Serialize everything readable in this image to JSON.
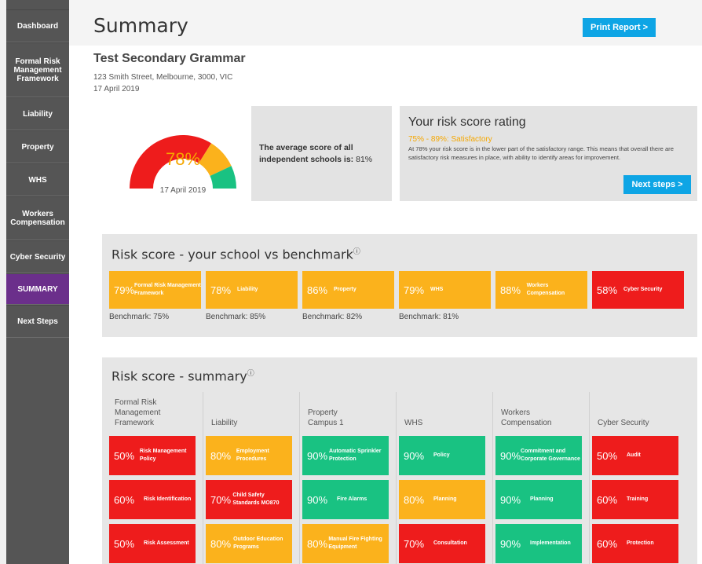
{
  "sidebar": {
    "items": [
      {
        "label": "Dashboard",
        "active": false
      },
      {
        "label": "Formal Risk Management Framework",
        "active": false
      },
      {
        "label": "Liability",
        "active": false
      },
      {
        "label": "Property",
        "active": false
      },
      {
        "label": "WHS",
        "active": false
      },
      {
        "label": "Workers Compensation",
        "active": false
      },
      {
        "label": "Cyber Security",
        "active": false
      },
      {
        "label": "SUMMARY",
        "active": true
      },
      {
        "label": "Next Steps",
        "active": false
      }
    ]
  },
  "header": {
    "title": "Summary",
    "print_label": "Print Report >"
  },
  "school": {
    "name": "Test Secondary Grammar",
    "address": "123 Smith Street, Melbourne, 3000, VIC",
    "date": "17 April 2019"
  },
  "gauge": {
    "score_text": "78%",
    "score": 78,
    "date": "17 April 2019"
  },
  "average": {
    "label": "The average score of all independent schools is:",
    "value": "81%"
  },
  "rating": {
    "title": "Your risk score rating",
    "range": "75% - 89%: Satisfactory",
    "description": "At 78% your risk score is in the lower part of the satisfactory range. This means that overall there are satisfactory risk measures in place, with ability to identify areas for improvement.",
    "next_label": "Next steps >"
  },
  "benchmark": {
    "title": "Risk score - your school vs benchmark",
    "info_icon": "ⓘ",
    "tiles": [
      {
        "pct": "79%",
        "label": "Formal Risk Management Framework",
        "status": "amber",
        "benchmark": "Benchmark: 75%"
      },
      {
        "pct": "78%",
        "label": "Liability",
        "status": "amber",
        "benchmark": "Benchmark: 85%"
      },
      {
        "pct": "86%",
        "label": "Property",
        "status": "amber",
        "benchmark": "Benchmark: 82%"
      },
      {
        "pct": "79%",
        "label": "WHS",
        "status": "amber",
        "benchmark": "Benchmark: 81%"
      },
      {
        "pct": "88%",
        "label": "Workers Compensation",
        "status": "amber",
        "benchmark": ""
      },
      {
        "pct": "58%",
        "label": "Cyber Security",
        "status": "red",
        "benchmark": ""
      }
    ]
  },
  "summary": {
    "title": "Risk score - summary",
    "info_icon": "ⓘ",
    "columns": [
      {
        "heading": "Formal Risk\nManagement\nFramework",
        "tiles": [
          {
            "pct": "50%",
            "label": "Risk Management Policy",
            "status": "red"
          },
          {
            "pct": "60%",
            "label": "Risk Identification",
            "status": "red"
          },
          {
            "pct": "50%",
            "label": "Risk Assessment",
            "status": "red"
          }
        ]
      },
      {
        "heading": "Liability",
        "tiles": [
          {
            "pct": "80%",
            "label": "Employment Procedures",
            "status": "amber"
          },
          {
            "pct": "70%",
            "label": "Child Safety Standards MO870",
            "status": "red"
          },
          {
            "pct": "80%",
            "label": "Outdoor Education Programs",
            "status": "amber"
          }
        ]
      },
      {
        "heading": "Property\nCampus 1",
        "tiles": [
          {
            "pct": "90%",
            "label": "Automatic Sprinkler Protection",
            "status": "green"
          },
          {
            "pct": "90%",
            "label": "Fire Alarms",
            "status": "green"
          },
          {
            "pct": "80%",
            "label": "Manual Fire Fighting Equipment",
            "status": "amber"
          }
        ]
      },
      {
        "heading": "WHS",
        "tiles": [
          {
            "pct": "90%",
            "label": "Policy",
            "status": "green"
          },
          {
            "pct": "80%",
            "label": "Planning",
            "status": "amber"
          },
          {
            "pct": "70%",
            "label": "Consultation",
            "status": "red"
          }
        ]
      },
      {
        "heading": "Workers\nCompensation",
        "tiles": [
          {
            "pct": "90%",
            "label": "Commitment and Corporate Governance",
            "status": "green"
          },
          {
            "pct": "90%",
            "label": "Planning",
            "status": "green"
          },
          {
            "pct": "90%",
            "label": "Implementation",
            "status": "green"
          }
        ]
      },
      {
        "heading": "Cyber Security",
        "tiles": [
          {
            "pct": "50%",
            "label": "Audit",
            "status": "red"
          },
          {
            "pct": "60%",
            "label": "Training",
            "status": "red"
          },
          {
            "pct": "60%",
            "label": "Protection",
            "status": "red"
          }
        ]
      }
    ]
  },
  "colors": {
    "red": "#ee1c1c",
    "amber": "#fbb21c",
    "green": "#19c282",
    "accent": "#0ea5e5",
    "active_nav": "#6b2f8b"
  }
}
